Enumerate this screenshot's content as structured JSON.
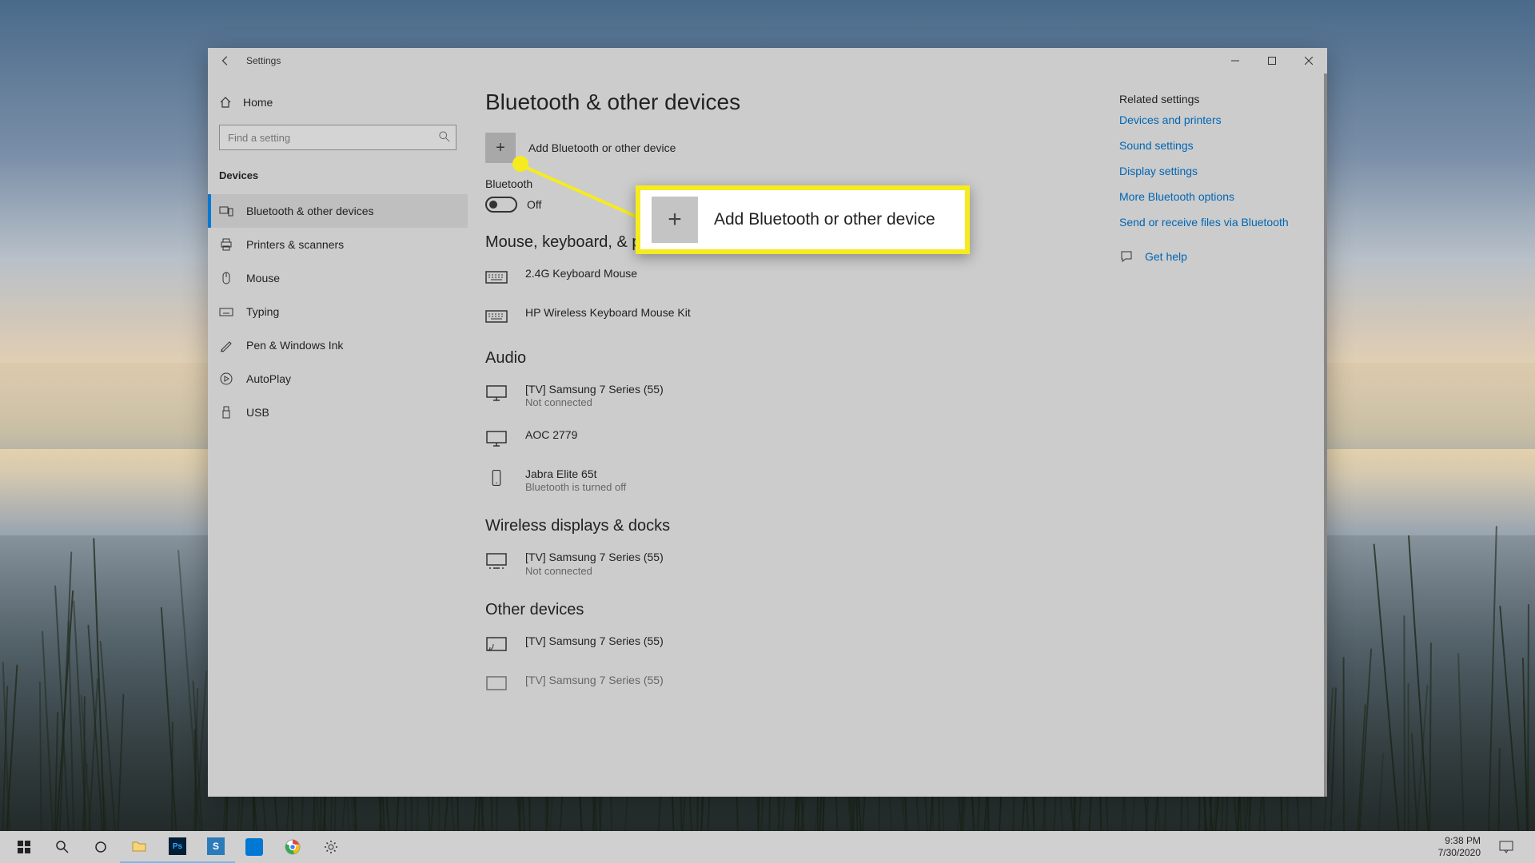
{
  "window": {
    "title": "Settings"
  },
  "sidebar": {
    "home": "Home",
    "search_placeholder": "Find a setting",
    "category": "Devices",
    "items": [
      {
        "label": "Bluetooth & other devices"
      },
      {
        "label": "Printers & scanners"
      },
      {
        "label": "Mouse"
      },
      {
        "label": "Typing"
      },
      {
        "label": "Pen & Windows Ink"
      },
      {
        "label": "AutoPlay"
      },
      {
        "label": "USB"
      }
    ]
  },
  "page": {
    "heading": "Bluetooth & other devices",
    "add_label": "Add Bluetooth or other device",
    "bluetooth_label": "Bluetooth",
    "bluetooth_state": "Off",
    "sections": {
      "mouse_kb": {
        "title": "Mouse, keyboard, & pen",
        "devices": [
          {
            "name": "2.4G Keyboard Mouse",
            "icon": "keyboard"
          },
          {
            "name": "HP Wireless Keyboard Mouse Kit",
            "icon": "keyboard"
          }
        ]
      },
      "audio": {
        "title": "Audio",
        "devices": [
          {
            "name": "[TV] Samsung 7 Series (55)",
            "status": "Not connected",
            "icon": "monitor"
          },
          {
            "name": "AOC 2779",
            "icon": "monitor"
          },
          {
            "name": "Jabra Elite 65t",
            "status": "Bluetooth is turned off",
            "icon": "phone"
          }
        ]
      },
      "wireless": {
        "title": "Wireless displays & docks",
        "devices": [
          {
            "name": "[TV] Samsung 7 Series (55)",
            "status": "Not connected",
            "icon": "monitor-dots"
          }
        ]
      },
      "other": {
        "title": "Other devices",
        "devices": [
          {
            "name": "[TV] Samsung 7 Series (55)",
            "icon": "cast"
          },
          {
            "name": "[TV] Samsung 7 Series (55)",
            "icon": "cast"
          }
        ]
      }
    }
  },
  "aside": {
    "related_title": "Related settings",
    "links": [
      "Devices and printers",
      "Sound settings",
      "Display settings",
      "More Bluetooth options",
      "Send or receive files via Bluetooth"
    ],
    "help": "Get help"
  },
  "callout": {
    "text": "Add Bluetooth or other device"
  },
  "taskbar": {
    "time": "9:38 PM",
    "date": "7/30/2020"
  }
}
